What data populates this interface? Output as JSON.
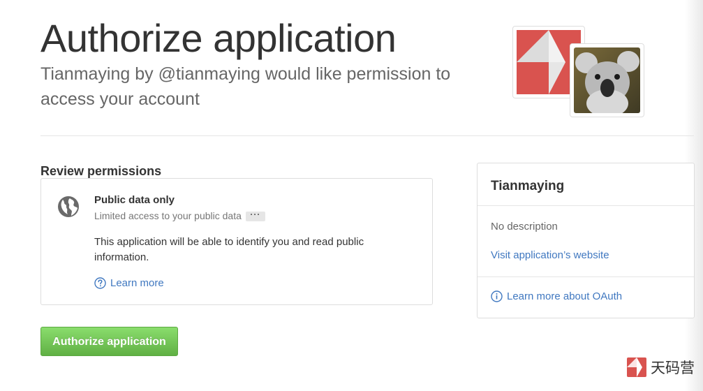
{
  "header": {
    "title": "Authorize application",
    "subtitle_app": "Tianmaying",
    "subtitle_by": " by ",
    "subtitle_user": "@tianmaying",
    "subtitle_rest": " would like permission to access your account"
  },
  "logos": {
    "app_logo_icon": "tianmaying-logo-icon",
    "user_avatar_icon": "koala-avatar"
  },
  "review": {
    "heading": "Review permissions",
    "permission": {
      "icon": "globe-icon",
      "title": "Public data only",
      "subtitle": "Limited access to your public data",
      "more_label": "···",
      "description": "This application will be able to identify you and read public information.",
      "learn_more": "Learn more"
    }
  },
  "actions": {
    "authorize_label": "Authorize application"
  },
  "sidebar": {
    "app_name": "Tianmaying",
    "description": "No description",
    "website_link": "Visit application’s website",
    "oauth_link": "Learn more about OAuth"
  },
  "watermark": {
    "text": "天码营"
  },
  "colors": {
    "link": "#4078c0",
    "button_green": "#60b044",
    "logo_red": "#d9534f"
  }
}
